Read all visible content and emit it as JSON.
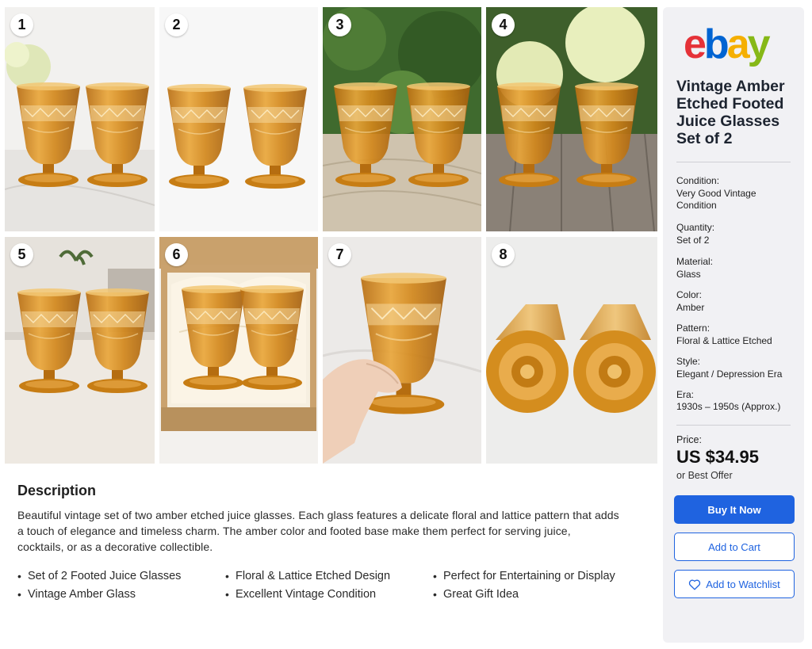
{
  "photos": [
    {
      "number": "1",
      "scene": "marble"
    },
    {
      "number": "2",
      "scene": "white"
    },
    {
      "number": "3",
      "scene": "stone-greenery"
    },
    {
      "number": "4",
      "scene": "wood-flowers"
    },
    {
      "number": "5",
      "scene": "linen-room"
    },
    {
      "number": "6",
      "scene": "gift-box"
    },
    {
      "number": "7",
      "scene": "hand"
    },
    {
      "number": "8",
      "scene": "bottom-view"
    }
  ],
  "description": {
    "heading": "Description",
    "body": "Beautiful vintage set of two amber etched juice glasses.  Each glass features a delicate floral and lattice pattern that adds a touch of elegance and timeless charm. The amber color and footed base make them perfect for serving juice, cocktails, or as a decorative collectible.",
    "bullets": [
      "Set of 2 Footed Juice Glasses",
      "Floral & Lattice Etched Design",
      "Perfect for Entertaining or Display",
      "Vintage Amber Glass",
      "Excellent Vintage Condition",
      "Great Gift Idea"
    ]
  },
  "sidebar": {
    "logo_letters": [
      {
        "char": "e",
        "color": "#e53238"
      },
      {
        "char": "b",
        "color": "#0064d2"
      },
      {
        "char": "a",
        "color": "#f5af02"
      },
      {
        "char": "y",
        "color": "#86b817"
      }
    ],
    "title": "Vintage Amber Etched Footed Juice Glasses Set of 2",
    "specs": [
      {
        "label": "Condition:",
        "value": "Very Good Vintage Condition"
      },
      {
        "label": "Quantity:",
        "value": "Set of 2"
      },
      {
        "label": "Material:",
        "value": "Glass"
      },
      {
        "label": "Color:",
        "value": "Amber"
      },
      {
        "label": "Pattern:",
        "value": "Floral & Lattice Etched"
      },
      {
        "label": "Style:",
        "value": "Elegant / Depression Era"
      },
      {
        "label": "Era:",
        "value": "1930s – 1950s (Approx.)"
      }
    ],
    "price_label": "Price:",
    "price": "US $34.95",
    "offer": "or Best Offer",
    "buttons": {
      "buy": "Buy It Now",
      "cart": "Add to Cart",
      "watch": "Add to Watchlist"
    }
  },
  "colors": {
    "accent": "#1f63e0",
    "amber": "#d48d1e",
    "sidebar_bg": "#f1f1f4"
  }
}
